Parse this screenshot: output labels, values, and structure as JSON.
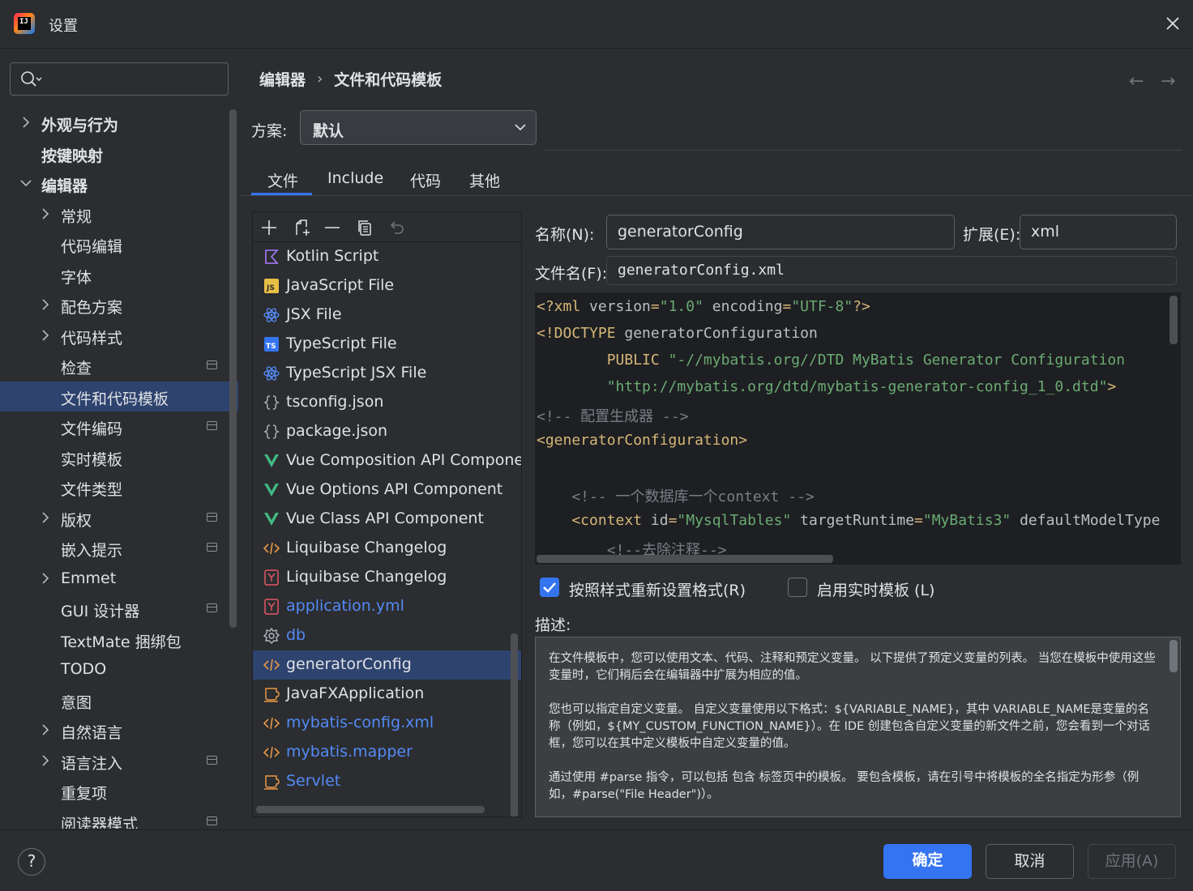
{
  "window": {
    "title": "设置",
    "logo_text": "IJ"
  },
  "search": {
    "value": ""
  },
  "sidebar": {
    "items": [
      {
        "label": "外观与行为",
        "level": 0,
        "expandable": true,
        "expanded": false,
        "bold": true,
        "modified": false
      },
      {
        "label": "按键映射",
        "level": 0,
        "expandable": false,
        "bold": true,
        "modified": false
      },
      {
        "label": "编辑器",
        "level": 0,
        "expandable": true,
        "expanded": true,
        "bold": true,
        "modified": false
      },
      {
        "label": "常规",
        "level": 1,
        "expandable": true,
        "modified": false
      },
      {
        "label": "代码编辑",
        "level": 1,
        "expandable": false,
        "modified": false
      },
      {
        "label": "字体",
        "level": 1,
        "expandable": false,
        "modified": false
      },
      {
        "label": "配色方案",
        "level": 1,
        "expandable": true,
        "modified": false
      },
      {
        "label": "代码样式",
        "level": 1,
        "expandable": true,
        "modified": false
      },
      {
        "label": "检查",
        "level": 1,
        "expandable": false,
        "modified": true
      },
      {
        "label": "文件和代码模板",
        "level": 1,
        "expandable": false,
        "modified": false,
        "selected": true
      },
      {
        "label": "文件编码",
        "level": 1,
        "expandable": false,
        "modified": true
      },
      {
        "label": "实时模板",
        "level": 1,
        "expandable": false,
        "modified": false
      },
      {
        "label": "文件类型",
        "level": 1,
        "expandable": false,
        "modified": false
      },
      {
        "label": "版权",
        "level": 1,
        "expandable": true,
        "modified": true
      },
      {
        "label": "嵌入提示",
        "level": 1,
        "expandable": false,
        "modified": true
      },
      {
        "label": "Emmet",
        "level": 1,
        "expandable": true,
        "modified": false
      },
      {
        "label": "GUI 设计器",
        "level": 1,
        "expandable": false,
        "modified": true
      },
      {
        "label": "TextMate 捆绑包",
        "level": 1,
        "expandable": false,
        "modified": false
      },
      {
        "label": "TODO",
        "level": 1,
        "expandable": false,
        "modified": false
      },
      {
        "label": "意图",
        "level": 1,
        "expandable": false,
        "modified": false
      },
      {
        "label": "自然语言",
        "level": 1,
        "expandable": true,
        "modified": false
      },
      {
        "label": "语言注入",
        "level": 1,
        "expandable": true,
        "modified": true
      },
      {
        "label": "重复项",
        "level": 1,
        "expandable": false,
        "modified": false
      },
      {
        "label": "阅读器模式",
        "level": 1,
        "expandable": false,
        "modified": true
      }
    ]
  },
  "breadcrumb": {
    "parent": "编辑器",
    "separator": "›",
    "current": "文件和代码模板"
  },
  "nav": {
    "back": "←",
    "forward": "→"
  },
  "scheme": {
    "label": "方案:",
    "value": "默认"
  },
  "tabs": [
    {
      "label": "文件",
      "active": true
    },
    {
      "label": "Include",
      "active": false
    },
    {
      "label": "代码",
      "active": false
    },
    {
      "label": "其他",
      "active": false
    }
  ],
  "templates": [
    {
      "name": "Kotlin Script",
      "icon": "kotlin-icon",
      "link": false
    },
    {
      "name": "JavaScript File",
      "icon": "javascript-icon",
      "link": false
    },
    {
      "name": "JSX File",
      "icon": "react-icon",
      "link": false
    },
    {
      "name": "TypeScript File",
      "icon": "typescript-icon",
      "link": false
    },
    {
      "name": "TypeScript JSX File",
      "icon": "react-icon",
      "link": false
    },
    {
      "name": "tsconfig.json",
      "icon": "json-icon",
      "link": false
    },
    {
      "name": "package.json",
      "icon": "json-icon",
      "link": false
    },
    {
      "name": "Vue Composition API Component",
      "icon": "vue-icon",
      "link": false
    },
    {
      "name": "Vue Options API Component",
      "icon": "vue-icon",
      "link": false
    },
    {
      "name": "Vue Class API Component",
      "icon": "vue-icon",
      "link": false
    },
    {
      "name": "Liquibase Changelog",
      "icon": "xml-icon",
      "link": false
    },
    {
      "name": "Liquibase Changelog",
      "icon": "yaml-icon",
      "link": false
    },
    {
      "name": "application.yml",
      "icon": "yaml-icon",
      "link": true
    },
    {
      "name": "db",
      "icon": "gear-icon",
      "link": true
    },
    {
      "name": "generatorConfig",
      "icon": "xml-icon",
      "link": false,
      "selected": true
    },
    {
      "name": "JavaFXApplication",
      "icon": "java-class-icon",
      "link": false
    },
    {
      "name": "mybatis-config.xml",
      "icon": "xml-icon",
      "link": true
    },
    {
      "name": "mybatis.mapper",
      "icon": "xml-icon",
      "link": true
    },
    {
      "name": "Servlet",
      "icon": "java-class-icon",
      "link": true
    }
  ],
  "form": {
    "name_label": "名称(N):",
    "name_value": "generatorConfig",
    "ext_label": "扩展(E):",
    "ext_value": "xml",
    "filename_label": "文件名(F):",
    "filename_value": "generatorConfig.xml"
  },
  "code_lines": [
    [
      [
        "tag",
        "<?xml "
      ],
      [
        "attr",
        "version"
      ],
      [
        "tag",
        "="
      ],
      [
        "str",
        "\"1.0\""
      ],
      [
        "attr",
        " encoding"
      ],
      [
        "tag",
        "="
      ],
      [
        "str",
        "\"UTF-8\""
      ],
      [
        "tag",
        "?>"
      ]
    ],
    [
      [
        "tag",
        "<!DOCTYPE "
      ],
      [
        "attr",
        "generatorConfiguration"
      ]
    ],
    [
      [
        "attr",
        "        "
      ],
      [
        "tag",
        "PUBLIC "
      ],
      [
        "str",
        "\"-//mybatis.org//DTD MyBatis Generator Configuration"
      ]
    ],
    [
      [
        "attr",
        "        "
      ],
      [
        "str",
        "\"http://mybatis.org/dtd/mybatis-generator-config_1_0.dtd\""
      ],
      [
        "tag",
        ">"
      ]
    ],
    [
      [
        "cmt",
        "<!-- 配置生成器 -->"
      ]
    ],
    [
      [
        "tag",
        "<generatorConfiguration>"
      ]
    ],
    [
      [
        "attr",
        ""
      ]
    ],
    [
      [
        "cmt",
        "    <!-- 一个数据库一个context -->"
      ]
    ],
    [
      [
        "tag",
        "    <context "
      ],
      [
        "attr",
        "id"
      ],
      [
        "tag",
        "="
      ],
      [
        "str",
        "\"MysqlTables\""
      ],
      [
        "attr",
        " targetRuntime"
      ],
      [
        "tag",
        "="
      ],
      [
        "str",
        "\"MyBatis3\""
      ],
      [
        "attr",
        " defaultModelType"
      ]
    ],
    [
      [
        "cmt",
        "        <!--去除注释-->"
      ]
    ]
  ],
  "options": {
    "reformat_label": "按照样式重新设置格式(R)",
    "reformat_checked": true,
    "live_template_label": "启用实时模板 (L)",
    "live_template_checked": false
  },
  "description": {
    "label": "描述:",
    "p1": "在文件模板中，您可以使用文本、代码、注释和预定义变量。 以下提供了预定义变量的列表。 当您在模板中使用这些变量时，它们稍后会在编辑器中扩展为相应的值。",
    "p2": "您也可以指定自定义变量。 自定义变量使用以下格式：${VARIABLE_NAME}，其中 VARIABLE_NAME是变量的名称（例如，${MY_CUSTOM_FUNCTION_NAME}）。在 IDE 创建包含自定义变量的新文件之前，您会看到一个对话框，您可以在其中定义模板中自定义变量的值。",
    "p3": "通过使用 #parse 指令，可以包括 包含 标签页中的模板。 要包含模板，请在引号中将模板的全名指定为形参（例如，#parse(\"File Header\")）。"
  },
  "buttons": {
    "help": "?",
    "ok": "确定",
    "cancel": "取消",
    "apply": "应用(A)"
  },
  "colors": {
    "accent": "#3574f0",
    "selection": "#2e436e",
    "link": "#548af7",
    "xml_tag": "#d5b778",
    "string": "#6aab73",
    "comment": "#7a7e85"
  }
}
